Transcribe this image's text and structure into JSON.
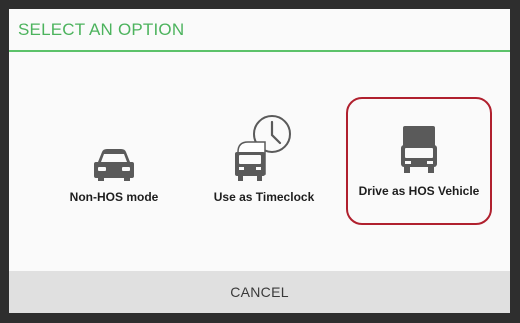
{
  "dialog": {
    "title": "SELECT AN OPTION",
    "accent_color": "#4cb35d",
    "highlight_color": "#b0202e"
  },
  "options": [
    {
      "label": "Non-HOS mode",
      "icon": "car-icon"
    },
    {
      "label": "Use as Timeclock",
      "icon": "truck-clock-icon"
    },
    {
      "label": "Drive as HOS Vehicle",
      "icon": "truck-icon",
      "highlighted": true
    }
  ],
  "footer": {
    "cancel_label": "CANCEL"
  }
}
